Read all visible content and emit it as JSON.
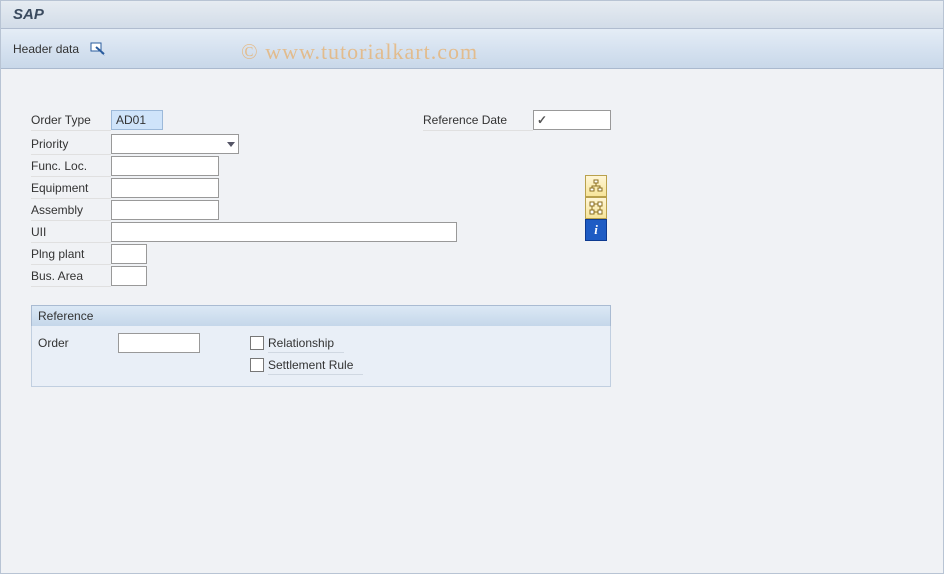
{
  "window": {
    "title": "SAP"
  },
  "toolbar": {
    "header_data_label": "Header data"
  },
  "form": {
    "order_type_label": "Order Type",
    "order_type_value": "AD01",
    "reference_date_label": "Reference Date",
    "reference_date_value": "",
    "priority_label": "Priority",
    "priority_value": "",
    "func_loc_label": "Func. Loc.",
    "func_loc_value": "",
    "equipment_label": "Equipment",
    "equipment_value": "",
    "assembly_label": "Assembly",
    "assembly_value": "",
    "uii_label": "UII",
    "uii_value": "",
    "plng_plant_label": "Plng plant",
    "plng_plant_value": "",
    "bus_area_label": "Bus. Area",
    "bus_area_value": ""
  },
  "reference": {
    "panel_title": "Reference",
    "order_label": "Order",
    "order_value": "",
    "relationship_label": "Relationship",
    "settlement_rule_label": "Settlement Rule"
  },
  "watermark": "© www.tutorialkart.com",
  "icons": {
    "hierarchy": "hierarchy-icon",
    "struct": "structure-icon",
    "info": "info-icon",
    "header_data": "header-data-icon"
  }
}
